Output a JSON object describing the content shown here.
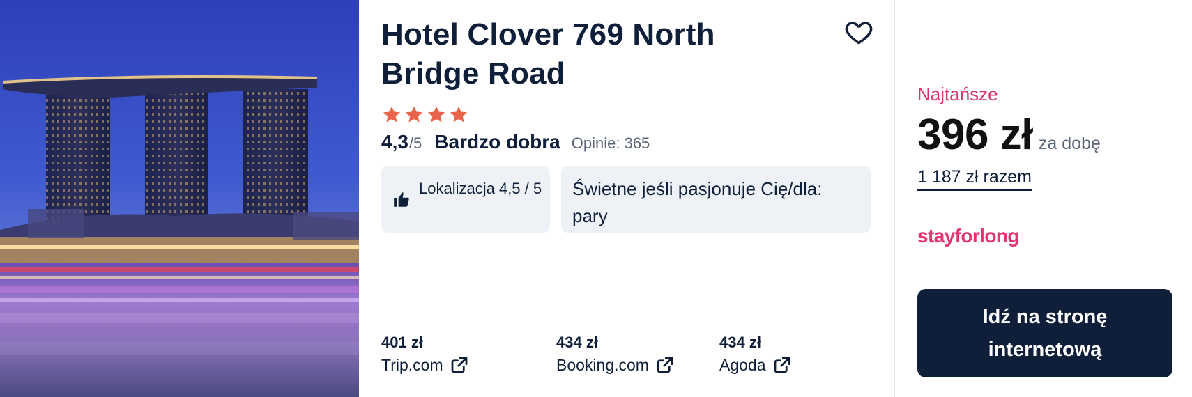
{
  "hotel": {
    "name": "Hotel Clover 769 North Bridge Road",
    "stars": 4,
    "rating_score": "4,3",
    "rating_max": "/5",
    "rating_text": "Bardzo dobra",
    "reviews_text": "Opinie: 365",
    "highlights": {
      "location_label": "Lokalizacja 4,5 / 5",
      "good_for_label": "Świetne jeśli pasjonuje Cię/dla: pary"
    },
    "icons": {
      "favorite": "heart-outline-icon",
      "star": "star-icon",
      "thumb": "thumbs-up-icon",
      "external": "external-link-icon"
    }
  },
  "offers": [
    {
      "price": "401 zł",
      "site": "Trip.com"
    },
    {
      "price": "434 zł",
      "site": "Booking.com"
    },
    {
      "price": "434 zł",
      "site": "Agoda"
    }
  ],
  "deal": {
    "cheapest_label": "Najtańsze",
    "price": "396 zł",
    "per_night": "za dobę",
    "total": "1 187 zł razem",
    "provider": "stayforlong",
    "cta_label": "Idź na stronę internetową"
  },
  "colors": {
    "navy": "#0f1f3a",
    "star": "#e8644a",
    "accent_pink": "#d9336f",
    "chip_bg": "#eef1f6"
  }
}
